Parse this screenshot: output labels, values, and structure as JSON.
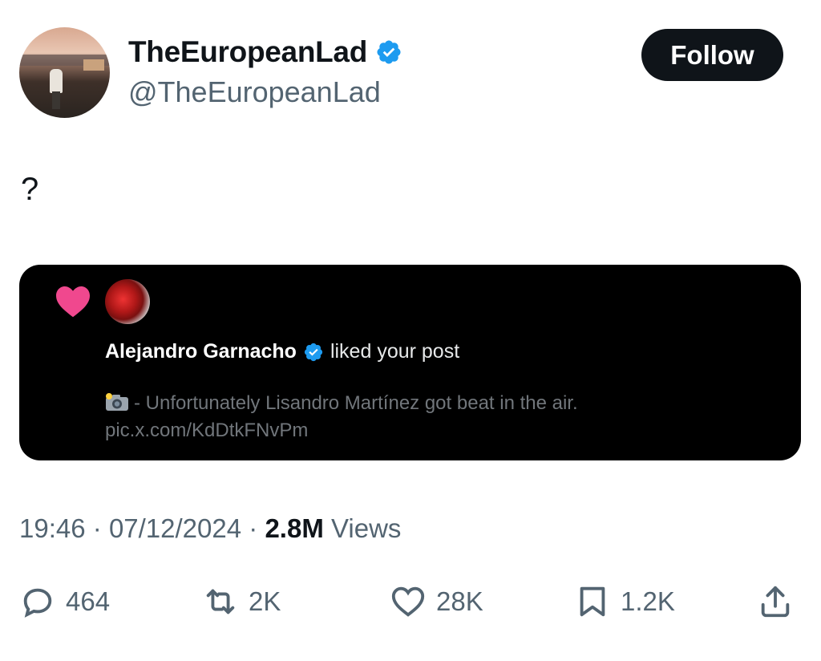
{
  "author": {
    "display_name": "TheEuropeanLad",
    "handle": "@TheEuropeanLad",
    "verified": true
  },
  "follow_button": {
    "label": "Follow"
  },
  "tweet": {
    "text": "?"
  },
  "embedded_notification": {
    "actor": "Alejandro Garnacho",
    "action_text": "liked your post",
    "post_snippet": "- Unfortunately Lisandro Martínez got beat in the air.",
    "post_link": "pic.x.com/KdDtkFNvPm"
  },
  "meta": {
    "time": "19:46",
    "separator": "·",
    "date": "07/12/2024",
    "views_count": "2.8M",
    "views_label": "Views"
  },
  "actions": {
    "replies": "464",
    "reposts": "2K",
    "likes": "28K",
    "bookmarks": "1.2K"
  },
  "colors": {
    "verified_blue": "#1d9bf0",
    "like_pink": "#f0488e",
    "text_primary": "#0f1419",
    "text_secondary": "#536471"
  }
}
